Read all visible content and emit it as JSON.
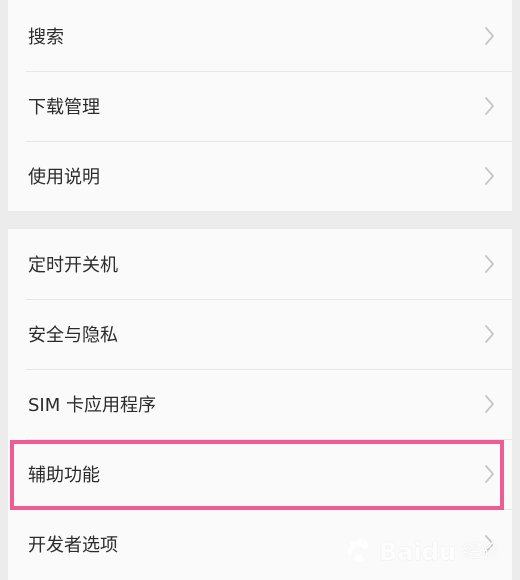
{
  "section1": {
    "items": [
      {
        "label": "搜索",
        "chevron_icon": "chevron-right-icon"
      },
      {
        "label": "下载管理",
        "chevron_icon": "chevron-right-icon"
      },
      {
        "label": "使用说明",
        "chevron_icon": "chevron-right-icon"
      }
    ]
  },
  "section2": {
    "items": [
      {
        "label": "定时开关机",
        "chevron_icon": "chevron-right-icon"
      },
      {
        "label": "安全与隐私",
        "chevron_icon": "chevron-right-icon"
      },
      {
        "label": "SIM 卡应用程序",
        "chevron_icon": "chevron-right-icon"
      },
      {
        "label": "辅助功能",
        "chevron_icon": "chevron-right-icon"
      },
      {
        "label": "开发者选项",
        "chevron_icon": "chevron-right-icon"
      }
    ]
  },
  "highlight": {
    "color": "#ef5b93"
  },
  "watermark": {
    "brand": "Bai",
    "brand_suffix": "du",
    "service": "经验"
  }
}
